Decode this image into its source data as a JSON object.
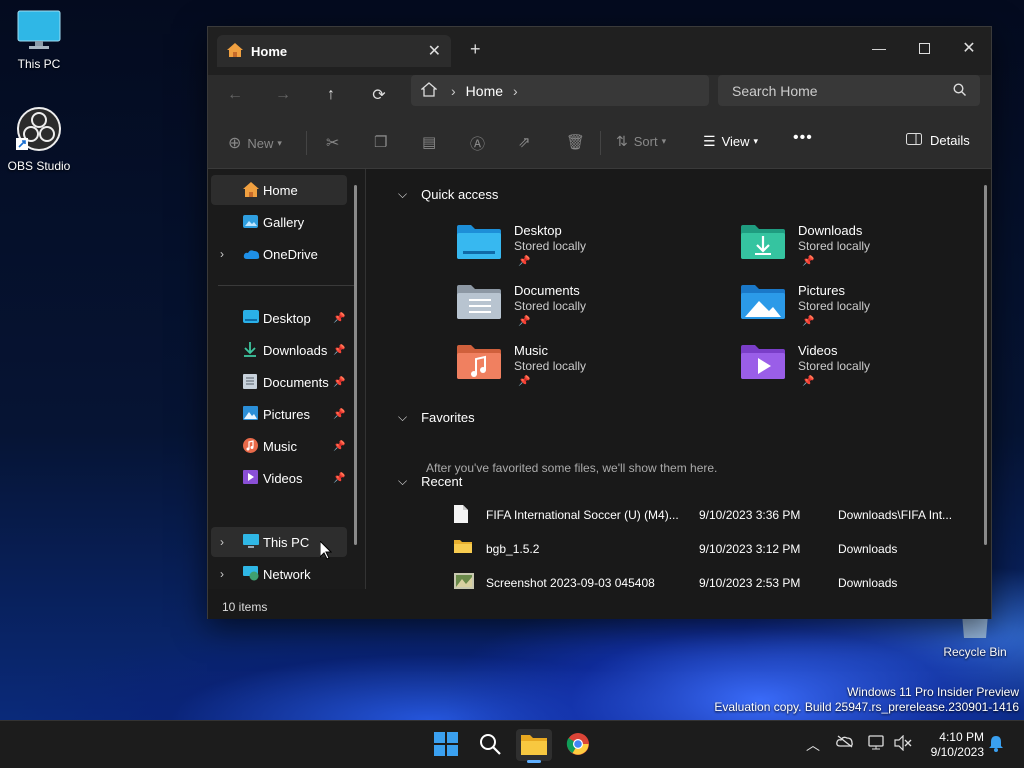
{
  "desktop": {
    "icons": [
      {
        "label": "This PC"
      },
      {
        "label": "OBS Studio"
      },
      {
        "label": "Recycle Bin"
      }
    ],
    "watermark_line1": "Windows 11 Pro Insider Preview",
    "watermark_line2": "Evaluation copy. Build 25947.rs_prerelease.230901-1416"
  },
  "window": {
    "tab_title": "Home",
    "address": {
      "crumb": "Home"
    },
    "search_placeholder": "Search Home",
    "toolbar": {
      "new_label": "New",
      "sort_label": "Sort",
      "view_label": "View",
      "details_label": "Details"
    }
  },
  "sidebar": {
    "top_items": [
      {
        "label": "Home"
      },
      {
        "label": "Gallery"
      },
      {
        "label": "OneDrive"
      }
    ],
    "pinned_items": [
      {
        "label": "Desktop"
      },
      {
        "label": "Downloads"
      },
      {
        "label": "Documents"
      },
      {
        "label": "Pictures"
      },
      {
        "label": "Music"
      },
      {
        "label": "Videos"
      }
    ],
    "bottom_items": [
      {
        "label": "This PC"
      },
      {
        "label": "Network"
      }
    ]
  },
  "main": {
    "quick_access_title": "Quick access",
    "quick_access": [
      {
        "name": "Desktop",
        "sub": "Stored locally"
      },
      {
        "name": "Downloads",
        "sub": "Stored locally"
      },
      {
        "name": "Documents",
        "sub": "Stored locally"
      },
      {
        "name": "Pictures",
        "sub": "Stored locally"
      },
      {
        "name": "Music",
        "sub": "Stored locally"
      },
      {
        "name": "Videos",
        "sub": "Stored locally"
      }
    ],
    "favorites_title": "Favorites",
    "favorites_empty": "After you've favorited some files, we'll show them here.",
    "recent_title": "Recent",
    "recent": [
      {
        "name": "FIFA International Soccer (U) (M4)...",
        "date": "9/10/2023 3:36 PM",
        "location": "Downloads\\FIFA Int..."
      },
      {
        "name": "bgb_1.5.2",
        "date": "9/10/2023 3:12 PM",
        "location": "Downloads"
      },
      {
        "name": "Screenshot 2023-09-03 045408",
        "date": "9/10/2023 2:53 PM",
        "location": "Downloads"
      }
    ]
  },
  "status": {
    "items_count": "10 items"
  },
  "taskbar": {
    "time": "4:10 PM",
    "date": "9/10/2023"
  },
  "colors": {
    "window_bg": "#191919",
    "accent": "#60b0ff"
  }
}
